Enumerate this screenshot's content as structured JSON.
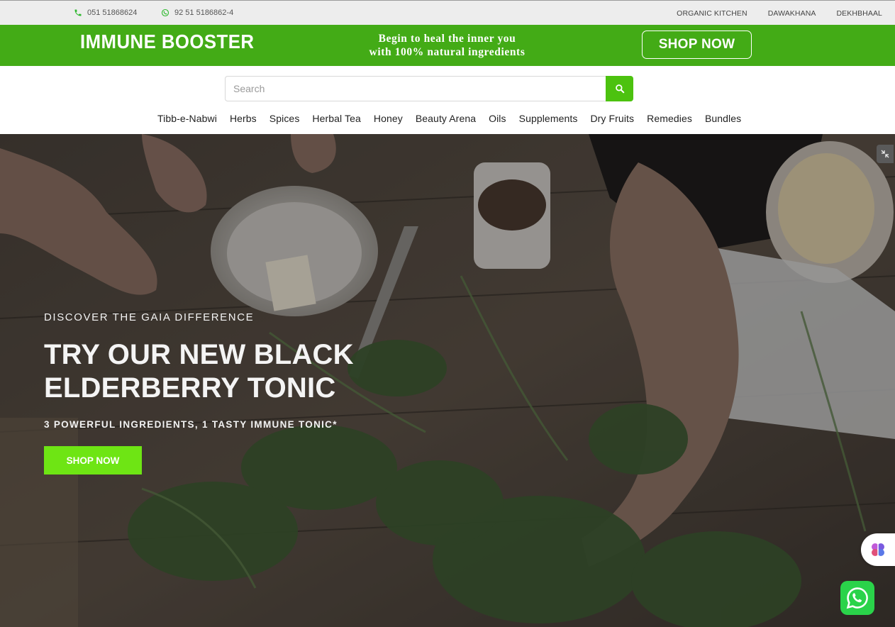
{
  "topbar": {
    "phone": "051 51868624",
    "whatsapp": "92 51 5186862-4",
    "links": [
      "ORGANIC KITCHEN",
      "DAWAKHANA",
      "DEKHBHAAL"
    ]
  },
  "promo": {
    "title": "IMMUNE BOOSTER",
    "tagline_line1": "Begin to heal the inner you",
    "tagline_line2": "with 100% natural ingredients",
    "button": "SHOP NOW"
  },
  "search": {
    "placeholder": "Search",
    "icon": "search-icon"
  },
  "nav": {
    "items": [
      "Tibb-e-Nabwi",
      "Herbs",
      "Spices",
      "Herbal Tea",
      "Honey",
      "Beauty Arena",
      "Oils",
      "Supplements",
      "Dry Fruits",
      "Remedies",
      "Bundles"
    ]
  },
  "hero": {
    "eyebrow": "DISCOVER THE GAIA DIFFERENCE",
    "title": "TRY OUR NEW BLACK ELDERBERRY TONIC",
    "subtitle": "3 POWERFUL INGREDIENTS, 1 TASTY IMMUNE TONIC*",
    "button": "SHOP NOW"
  },
  "colors": {
    "brand_green": "#43ab16",
    "search_green": "#4cc20f",
    "cta_green": "#6ee514",
    "whatsapp_green": "#2ad34a"
  }
}
